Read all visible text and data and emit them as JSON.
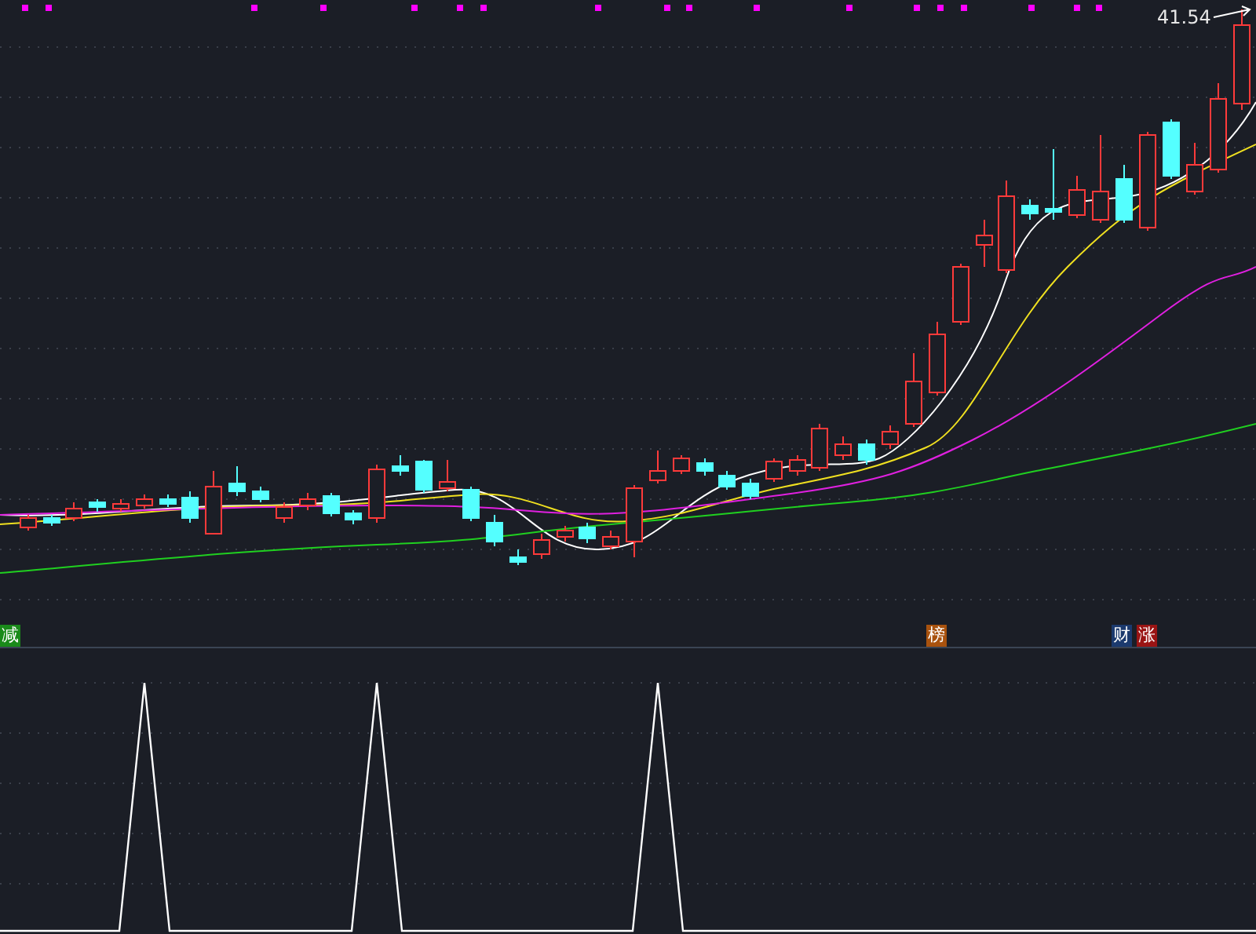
{
  "price_label": {
    "text": "41.54"
  },
  "signal_badges": [
    {
      "text": "减",
      "color": "#1a8a1a"
    },
    {
      "text": "榜",
      "color": "#a8520e"
    },
    {
      "text": "财",
      "color": "#1c3a6e"
    },
    {
      "text": "涨",
      "color": "#9a1414"
    }
  ]
}
